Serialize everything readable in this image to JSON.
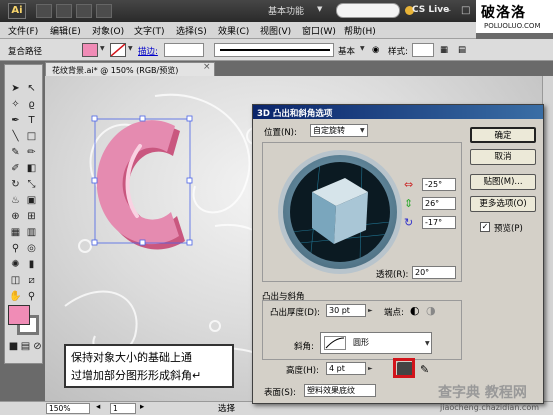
{
  "titlebar": {
    "app_logo": "Ai",
    "workspace": "基本功能",
    "cs_live": "CS Live",
    "window_buttons": [
      "–",
      "□",
      "×"
    ]
  },
  "site_logo": {
    "main": "破洛洛",
    "sub": "POLUOLUO.COM"
  },
  "menu": [
    "文件(F)",
    "编辑(E)",
    "对象(O)",
    "文字(T)",
    "选择(S)",
    "效果(C)",
    "视图(V)",
    "窗口(W)",
    "帮助(H)"
  ],
  "control": {
    "selection_label": "复合路径",
    "stroke_link": "描边:",
    "stroke_style": "基本",
    "style_label": "样式:",
    "fill_color": "#f08cb6"
  },
  "document_tab": {
    "title": "花纹背景.ai* @ 150% (RGB/预览)",
    "close": "×"
  },
  "status": {
    "zoom": "150%",
    "page": "1",
    "mode": "选择"
  },
  "dialog": {
    "title": "3D 凸出和斜角选项",
    "position_label": "位置(N):",
    "position_value": "自定旋转",
    "rotation": {
      "x": "-25°",
      "y": "26°",
      "z": "-17°"
    },
    "perspective_label": "透视(R):",
    "perspective_value": "20°",
    "extrude_section": "凸出与斜角",
    "extrude_depth_label": "凸出厚度(D):",
    "extrude_depth_value": "30 pt",
    "cap_label": "端点:",
    "bevel_label": "斜角:",
    "bevel_value": "圆形",
    "height_label": "高度(H):",
    "height_value": "4 pt",
    "surface_label": "表面(S):",
    "surface_value": "塑料效果底纹",
    "buttons": {
      "ok": "确定",
      "cancel": "取消",
      "map": "贴图(M)...",
      "more": "更多选项(O)"
    },
    "preview_label": "预览(P)",
    "preview_checked": true
  },
  "callout": {
    "line1": "保持对象大小的基础上通",
    "line2": "过增加部分图形形成斜角↵"
  },
  "watermark": {
    "main": "查字典 教程网",
    "sub": "jiaocheng.chazidian.com"
  },
  "colors": {
    "accent_pink": "#f08cb6",
    "highlight_red": "#d2141b",
    "dialog_title": "#0a246a"
  }
}
